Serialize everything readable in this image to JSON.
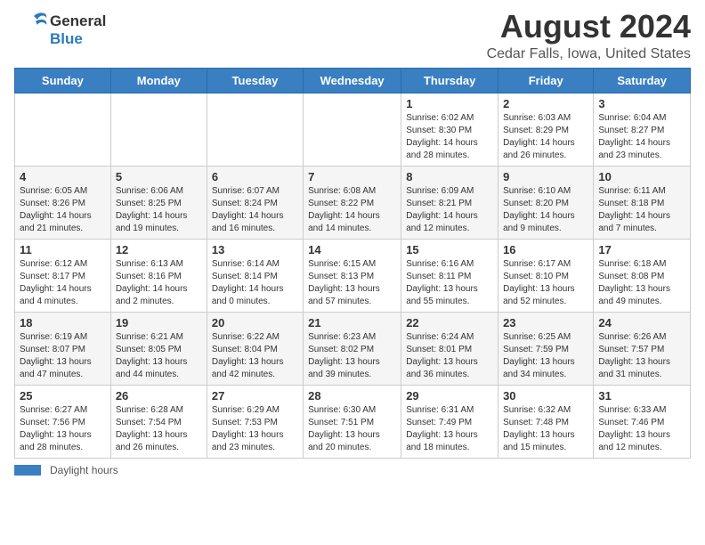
{
  "logo": {
    "general": "General",
    "blue": "Blue"
  },
  "header": {
    "title": "August 2024",
    "subtitle": "Cedar Falls, Iowa, United States"
  },
  "weekdays": [
    "Sunday",
    "Monday",
    "Tuesday",
    "Wednesday",
    "Thursday",
    "Friday",
    "Saturday"
  ],
  "weeks": [
    [
      {
        "day": "",
        "info": ""
      },
      {
        "day": "",
        "info": ""
      },
      {
        "day": "",
        "info": ""
      },
      {
        "day": "",
        "info": ""
      },
      {
        "day": "1",
        "info": "Sunrise: 6:02 AM\nSunset: 8:30 PM\nDaylight: 14 hours and 28 minutes."
      },
      {
        "day": "2",
        "info": "Sunrise: 6:03 AM\nSunset: 8:29 PM\nDaylight: 14 hours and 26 minutes."
      },
      {
        "day": "3",
        "info": "Sunrise: 6:04 AM\nSunset: 8:27 PM\nDaylight: 14 hours and 23 minutes."
      }
    ],
    [
      {
        "day": "4",
        "info": "Sunrise: 6:05 AM\nSunset: 8:26 PM\nDaylight: 14 hours and 21 minutes."
      },
      {
        "day": "5",
        "info": "Sunrise: 6:06 AM\nSunset: 8:25 PM\nDaylight: 14 hours and 19 minutes."
      },
      {
        "day": "6",
        "info": "Sunrise: 6:07 AM\nSunset: 8:24 PM\nDaylight: 14 hours and 16 minutes."
      },
      {
        "day": "7",
        "info": "Sunrise: 6:08 AM\nSunset: 8:22 PM\nDaylight: 14 hours and 14 minutes."
      },
      {
        "day": "8",
        "info": "Sunrise: 6:09 AM\nSunset: 8:21 PM\nDaylight: 14 hours and 12 minutes."
      },
      {
        "day": "9",
        "info": "Sunrise: 6:10 AM\nSunset: 8:20 PM\nDaylight: 14 hours and 9 minutes."
      },
      {
        "day": "10",
        "info": "Sunrise: 6:11 AM\nSunset: 8:18 PM\nDaylight: 14 hours and 7 minutes."
      }
    ],
    [
      {
        "day": "11",
        "info": "Sunrise: 6:12 AM\nSunset: 8:17 PM\nDaylight: 14 hours and 4 minutes."
      },
      {
        "day": "12",
        "info": "Sunrise: 6:13 AM\nSunset: 8:16 PM\nDaylight: 14 hours and 2 minutes."
      },
      {
        "day": "13",
        "info": "Sunrise: 6:14 AM\nSunset: 8:14 PM\nDaylight: 14 hours and 0 minutes."
      },
      {
        "day": "14",
        "info": "Sunrise: 6:15 AM\nSunset: 8:13 PM\nDaylight: 13 hours and 57 minutes."
      },
      {
        "day": "15",
        "info": "Sunrise: 6:16 AM\nSunset: 8:11 PM\nDaylight: 13 hours and 55 minutes."
      },
      {
        "day": "16",
        "info": "Sunrise: 6:17 AM\nSunset: 8:10 PM\nDaylight: 13 hours and 52 minutes."
      },
      {
        "day": "17",
        "info": "Sunrise: 6:18 AM\nSunset: 8:08 PM\nDaylight: 13 hours and 49 minutes."
      }
    ],
    [
      {
        "day": "18",
        "info": "Sunrise: 6:19 AM\nSunset: 8:07 PM\nDaylight: 13 hours and 47 minutes."
      },
      {
        "day": "19",
        "info": "Sunrise: 6:21 AM\nSunset: 8:05 PM\nDaylight: 13 hours and 44 minutes."
      },
      {
        "day": "20",
        "info": "Sunrise: 6:22 AM\nSunset: 8:04 PM\nDaylight: 13 hours and 42 minutes."
      },
      {
        "day": "21",
        "info": "Sunrise: 6:23 AM\nSunset: 8:02 PM\nDaylight: 13 hours and 39 minutes."
      },
      {
        "day": "22",
        "info": "Sunrise: 6:24 AM\nSunset: 8:01 PM\nDaylight: 13 hours and 36 minutes."
      },
      {
        "day": "23",
        "info": "Sunrise: 6:25 AM\nSunset: 7:59 PM\nDaylight: 13 hours and 34 minutes."
      },
      {
        "day": "24",
        "info": "Sunrise: 6:26 AM\nSunset: 7:57 PM\nDaylight: 13 hours and 31 minutes."
      }
    ],
    [
      {
        "day": "25",
        "info": "Sunrise: 6:27 AM\nSunset: 7:56 PM\nDaylight: 13 hours and 28 minutes."
      },
      {
        "day": "26",
        "info": "Sunrise: 6:28 AM\nSunset: 7:54 PM\nDaylight: 13 hours and 26 minutes."
      },
      {
        "day": "27",
        "info": "Sunrise: 6:29 AM\nSunset: 7:53 PM\nDaylight: 13 hours and 23 minutes."
      },
      {
        "day": "28",
        "info": "Sunrise: 6:30 AM\nSunset: 7:51 PM\nDaylight: 13 hours and 20 minutes."
      },
      {
        "day": "29",
        "info": "Sunrise: 6:31 AM\nSunset: 7:49 PM\nDaylight: 13 hours and 18 minutes."
      },
      {
        "day": "30",
        "info": "Sunrise: 6:32 AM\nSunset: 7:48 PM\nDaylight: 13 hours and 15 minutes."
      },
      {
        "day": "31",
        "info": "Sunrise: 6:33 AM\nSunset: 7:46 PM\nDaylight: 13 hours and 12 minutes."
      }
    ]
  ],
  "footer": {
    "daylight_label": "Daylight hours"
  }
}
